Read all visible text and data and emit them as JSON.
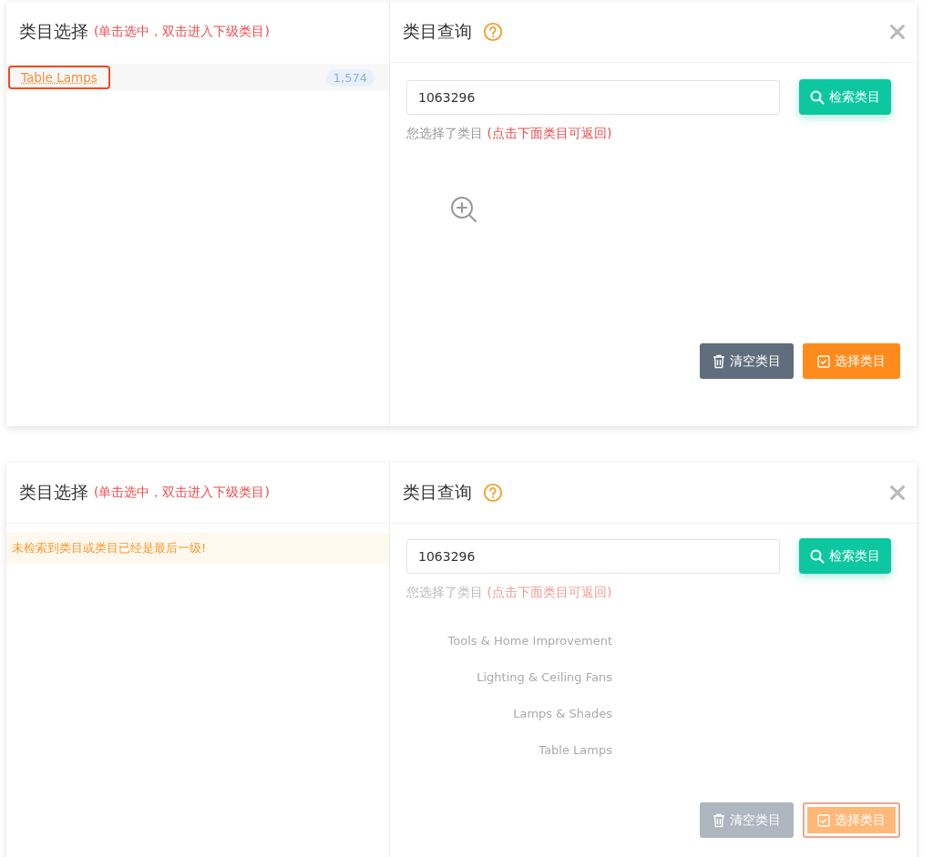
{
  "panels": [
    {
      "faded": false,
      "left": {
        "title": "类目选择",
        "hint": "(单击选中，双击进入下级类目)",
        "items": [
          {
            "label": "Table Lamps",
            "count": "1,574",
            "selected": true
          }
        ]
      },
      "right": {
        "title": "类目查询",
        "search": {
          "value": "1063296"
        },
        "search_button": "检索类目",
        "chosen_label": "您选择了类目",
        "chosen_hint": "(点击下面类目可返回)",
        "clear_button": "清空类目",
        "select_button": {
          "label": "选择类目",
          "focused": false
        }
      }
    },
    {
      "faded": true,
      "left": {
        "title": "类目选择",
        "hint": "(单击选中，双击进入下级类目)",
        "message": "未检索到类目或类目已经是最后一级!"
      },
      "right": {
        "title": "类目查询",
        "search": {
          "value": "1063296"
        },
        "search_button": "检索类目",
        "chosen_label": "您选择了类目",
        "chosen_hint": "(点击下面类目可返回)",
        "path": [
          "Tools & Home Improvement",
          "Lighting & Ceiling Fans",
          "Lamps & Shades",
          "Table Lamps"
        ],
        "clear_button": "清空类目",
        "select_button": {
          "label": "选择类目",
          "focused": true
        }
      }
    }
  ]
}
